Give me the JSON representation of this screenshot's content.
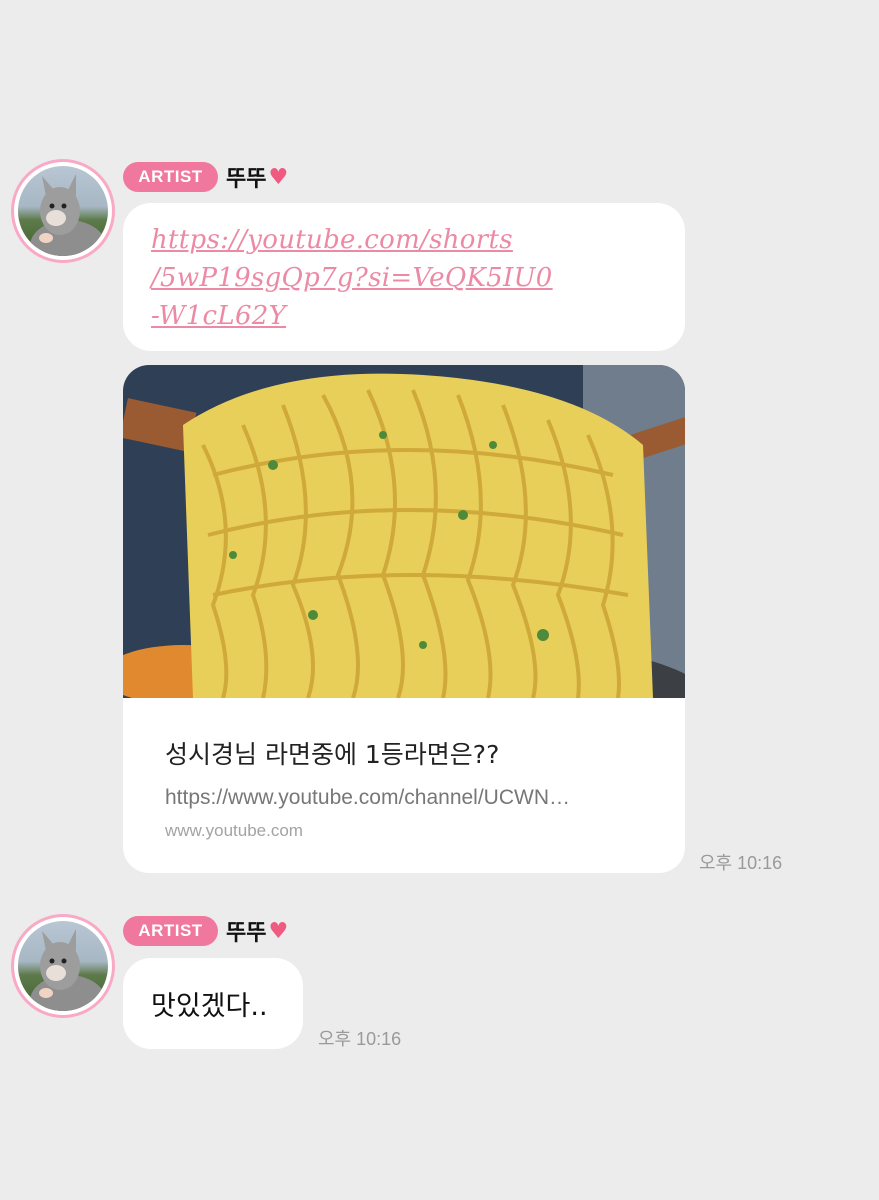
{
  "messages": [
    {
      "badge": "ARTIST",
      "sender": "뚜뚜",
      "heart": "♥",
      "link": "https://youtube.com/shorts/5wP19sgQp7g?si=VeQK5IU0-W1cL62Y",
      "link_lines": [
        "https://youtube.com/shorts",
        "/5wP19sgQp7g?si=VeQK5IU0",
        "-W1cL62Y"
      ],
      "preview": {
        "title": "성시경님 라면중에 1등라면은??",
        "url": "https://www.youtube.com/channel/UCWN…",
        "domain": "www.youtube.com"
      },
      "time": "오후 10:16"
    },
    {
      "badge": "ARTIST",
      "sender": "뚜뚜",
      "heart": "♥",
      "text": "맛있겠다..",
      "time": "오후 10:16"
    }
  ],
  "colors": {
    "background": "#ececec",
    "badge": "#f0789f",
    "avatar_ring": "#f9a9c5",
    "link": "#ec8aa5"
  }
}
